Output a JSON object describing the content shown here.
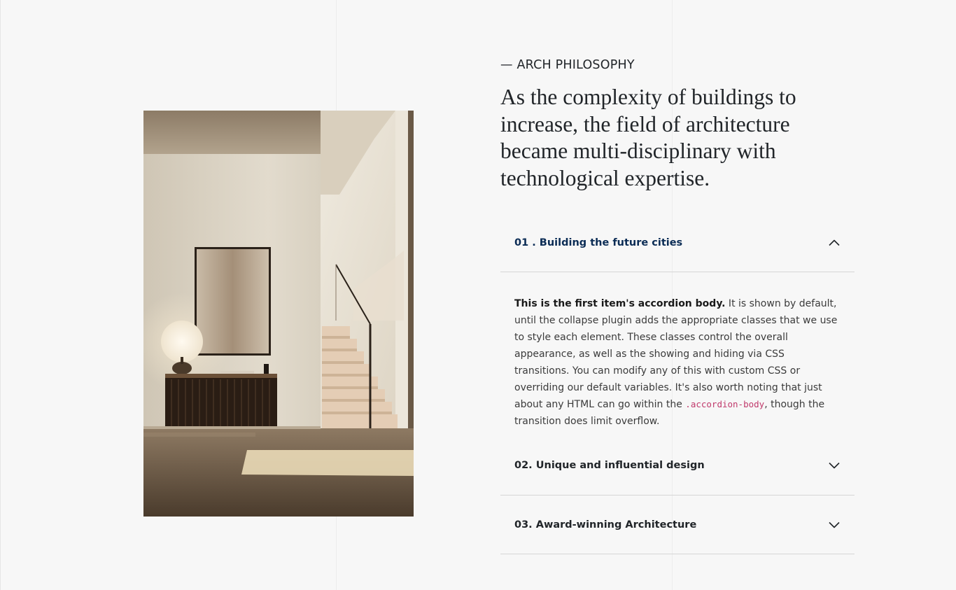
{
  "section": {
    "eyebrow": "— ARCH PHILOSOPHY",
    "heading": "As the complexity of buildings to increase, the field of architecture became multi-disciplinary with technological expertise."
  },
  "image": {
    "alt": "Minimal interior with staircase, framed artwork, globe lamp and dark sideboard"
  },
  "accordion": {
    "items": [
      {
        "title": "01 . Building the future cities",
        "expanded": true,
        "icon": "chevron-up-icon",
        "body": {
          "strong": "This is the first item's accordion body.",
          "text_before_code": " It is shown by default, until the collapse plugin adds the appropriate classes that we use to style each element. These classes control the overall appearance, as well as the showing and hiding via CSS transitions. You can modify any of this with custom CSS or overriding our default variables. It's also worth noting that just about any HTML can go within the ",
          "code": ".accordion-body",
          "text_after_code": ", though the transition does limit overflow."
        }
      },
      {
        "title": "02. Unique and influential design",
        "expanded": false,
        "icon": "chevron-down-icon"
      },
      {
        "title": "03. Award-winning Architecture",
        "expanded": false,
        "icon": "chevron-down-icon"
      }
    ]
  },
  "colors": {
    "background": "#f7f7f7",
    "active_title": "#0b2c55",
    "code": "#c0396b",
    "divider": "#d6d6d6"
  }
}
